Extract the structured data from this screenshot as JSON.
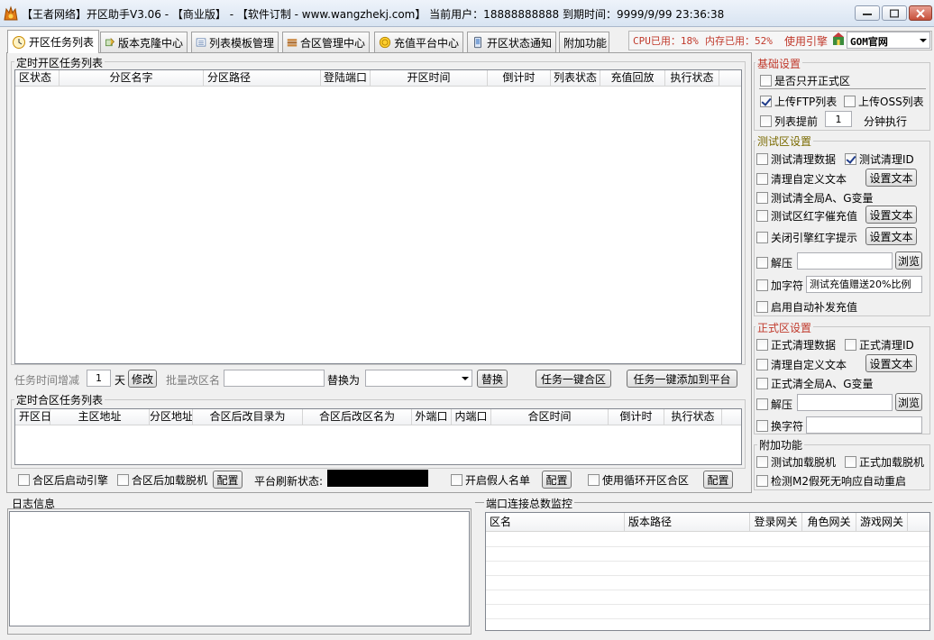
{
  "window": {
    "title": "【王者网络】开区助手V3.06 - 【商业版】 - 【软件订制 - www.wangzhekj.com】 当前用户：18888888888  到期时间：9999/9/99 23:36:38"
  },
  "tabs": [
    {
      "label": "开区任务列表",
      "icon": "clock-icon"
    },
    {
      "label": "版本克隆中心",
      "icon": "copy-icon"
    },
    {
      "label": "列表模板管理",
      "icon": "list-icon"
    },
    {
      "label": "合区管理中心",
      "icon": "stack-icon"
    },
    {
      "label": "充值平台中心",
      "icon": "coin-icon"
    },
    {
      "label": "开区状态通知",
      "icon": "phone-icon"
    },
    {
      "label": "附加功能",
      "icon": ""
    }
  ],
  "status": {
    "cpu": "CPU已用：18%",
    "mem": "内存已用：52%",
    "engine_label": "使用引擎",
    "engine_value": "GOM官网"
  },
  "open_tasks": {
    "title": "定时开区任务列表",
    "columns": [
      "区状态",
      "分区名字",
      "分区路径",
      "登陆端口",
      "开区时间",
      "倒计时",
      "列表状态",
      "充值回放",
      "执行状态"
    ],
    "time_inc_label": "任务时间增减",
    "time_inc_value": "1",
    "day_label": "天",
    "modify_btn": "修改",
    "batch_rename_label": "批量改区名",
    "replace_label": "替换为",
    "replace_btn": "替换",
    "merge_btn": "任务一键合区",
    "add_platform_btn": "任务一键添加到平台"
  },
  "merge_tasks": {
    "title": "定时合区任务列表",
    "columns": [
      "开区日",
      "主区地址",
      "分区地址",
      "合区后改目录为",
      "合区后改区名为",
      "外端口",
      "内端口",
      "合区时间",
      "倒计时",
      "执行状态"
    ],
    "start_engine_after": "合区后启动引擎",
    "load_offline_after": "合区后加载脱机",
    "config_btn": "配置",
    "platform_refresh_label": "平台刷新状态:",
    "fake_list": "开启假人名单",
    "loop_open": "使用循环开区合区"
  },
  "basic_settings": {
    "title": "基础设置",
    "only_official": "是否只开正式区",
    "upload_ftp": "上传FTP列表",
    "upload_oss": "上传OSS列表",
    "list_ahead": "列表提前",
    "list_ahead_value": "1",
    "minutes_exec": "分钟执行"
  },
  "test_settings": {
    "title": "测试区设置",
    "clear_data": "测试清理数据",
    "clear_id": "测试清理ID",
    "clear_custom_text": "清理自定义文本",
    "set_text_btn": "设置文本",
    "clear_global_vars": "测试清全局A、G变量",
    "red_recharge": "测试区红字催充值",
    "close_red_hint": "关闭引擎红字提示",
    "unzip": "解压",
    "browse_btn": "浏览",
    "add_char": "加字符",
    "add_char_value": "测试充值赠送20%比例",
    "auto_recharge": "启用自动补发充值"
  },
  "formal_settings": {
    "title": "正式区设置",
    "clear_data": "正式清理数据",
    "clear_id": "正式清理ID",
    "clear_custom_text": "清理自定义文本",
    "set_text_btn": "设置文本",
    "clear_global_vars": "正式清全局A、G变量",
    "unzip": "解压",
    "browse_btn": "浏览",
    "swap_char": "换字符"
  },
  "extra": {
    "title": "附加功能",
    "test_load_offline": "测试加载脱机",
    "formal_load_offline": "正式加载脱机",
    "detect_m2": "检测M2假死无响应自动重启"
  },
  "log": {
    "title": "日志信息"
  },
  "port_monitor": {
    "title": "端口连接总数监控",
    "columns": [
      "区名",
      "版本路径",
      "登录网关",
      "角色网关",
      "游戏网关"
    ]
  }
}
